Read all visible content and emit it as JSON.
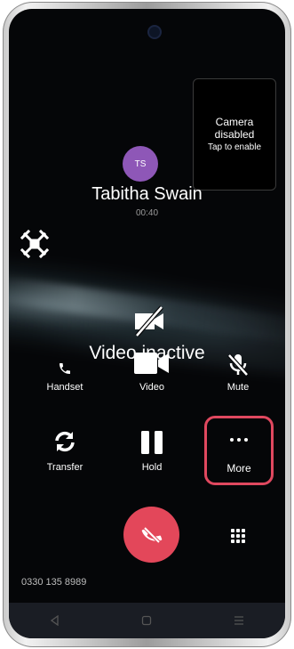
{
  "camera_preview": {
    "line1": "Camera",
    "line2": "disabled",
    "line3": "Tap to enable"
  },
  "caller": {
    "initials": "TS",
    "name": "Tabitha Swain",
    "duration": "00:40"
  },
  "video_status": "Video inactive",
  "controls": {
    "handset": "Handset",
    "video": "Video",
    "mute": "Mute",
    "transfer": "Transfer",
    "hold": "Hold",
    "more": "More"
  },
  "phone_number": "0330 135 8989",
  "colors": {
    "avatar": "#8e57b7",
    "end_call": "#e3475a",
    "highlight": "#e0485f"
  },
  "icons": [
    "crossed-tools-icon",
    "video-off-icon",
    "phone-icon",
    "video-icon",
    "mic-off-icon",
    "refresh-icon",
    "pause-icon",
    "more-dots-icon",
    "end-call-icon",
    "keypad-icon",
    "back-icon",
    "home-icon",
    "recents-icon"
  ]
}
